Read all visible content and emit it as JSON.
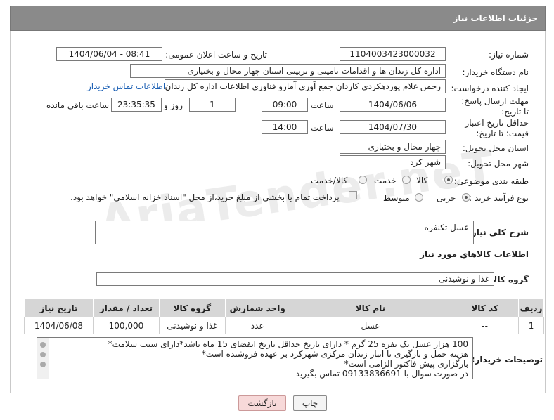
{
  "header": {
    "title": "جزئیات اطلاعات نیاز"
  },
  "form": {
    "need_number": {
      "label": "شماره نیاز:",
      "value": "1104003423000032"
    },
    "announce_datetime": {
      "label": "تاریخ و ساعت اعلان عمومی:",
      "value": "1404/06/04 - 08:41"
    },
    "buyer_org": {
      "label": "نام دستگاه خریدار:",
      "value": "اداره کل زندان ها و اقدامات تامینی و تربیتی استان چهار محال و بختیاری"
    },
    "requester": {
      "label": "ایجاد کننده درخواست:",
      "value": "رحمن غلام پوردهکردی کاردان جمع آوری آمارو فناوری اطلاعات اداره کل زندان ها",
      "contact_link": "اطلاعات تماس خریدار"
    },
    "reply_deadline": {
      "label": "مهلت ارسال پاسخ: تا تاریخ:",
      "date": "1404/06/06",
      "time_label": "ساعت",
      "time": "09:00",
      "days": "1",
      "days_label": "روز و",
      "remaining": "23:35:35",
      "remaining_label": "ساعت باقی مانده"
    },
    "price_validity": {
      "label": "حداقل تاریخ اعتبار قیمت: تا تاریخ:",
      "date": "1404/07/30",
      "time_label": "ساعت",
      "time": "14:00"
    },
    "delivery_province": {
      "label": "استان محل تحویل:",
      "value": "چهار محال و بختیاری"
    },
    "delivery_city": {
      "label": "شهر محل تحویل:",
      "value": "شهر کرد"
    },
    "category": {
      "label": "طبقه بندی موضوعی:",
      "options": [
        "کالا",
        "خدمت",
        "کالا/خدمت"
      ],
      "selected": "کالا"
    },
    "purchase_process": {
      "label": "نوع فرآیند خرید :",
      "options": [
        "جزیی",
        "متوسط"
      ],
      "note": "پرداخت تمام یا بخشی از مبلغ خرید،از محل \"اسناد خزانه اسلامی\" خواهد بود."
    }
  },
  "description": {
    "label": "شرح كلي نياز:",
    "value": "عسل تکنفره"
  },
  "goods_section": {
    "title": "اطلاعات كالاهاي مورد نياز",
    "group_label": "گروه کالا:",
    "group_value": "غذا و نوشیدنی"
  },
  "table": {
    "headers": [
      "ردیف",
      "کد کالا",
      "نام کالا",
      "واحد شمارش",
      "گروه کالا",
      "تعداد / مقدار",
      "تاریخ نیاز"
    ],
    "rows": [
      [
        "1",
        "--",
        "عسل",
        "عدد",
        "غذا و نوشیدنی",
        "100,000",
        "1404/06/08"
      ]
    ]
  },
  "buyer_notes": {
    "label": "توضیحات خریدار:",
    "lines": [
      "100 هزار عسل تک نفره 25 گرم * دارای تاریخ حداقل تاریخ انقضای 15 ماه باشد*دارای سیب سلامت*",
      "هزینه حمل و بارگیری تا انبار زندان مرکزی شهرکرد بر عهده فروشنده است*",
      "بارگزاری پیش فاکتور الزامی است*",
      "در صورت سوال با 09133836691 تماس بگیرید"
    ]
  },
  "buttons": {
    "print": "چاپ",
    "back": "بازگشت"
  },
  "watermark": "AriaTender.neT",
  "colors": {
    "titlebar": "#8a8a8a",
    "link": "#1a5fb4",
    "back_button": "#f7d9d9"
  }
}
